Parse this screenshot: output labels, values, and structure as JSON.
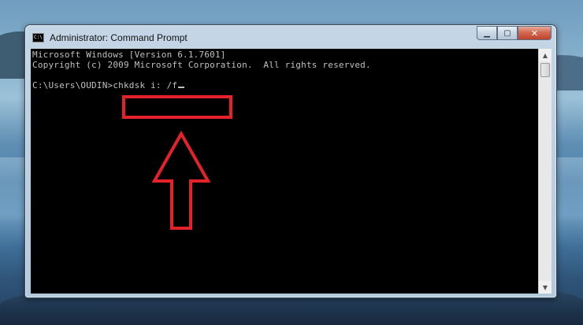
{
  "window": {
    "icon_text": "C:\\",
    "title": "Administrator: Command Prompt",
    "minimize_glyph": "▁",
    "maximize_glyph": "▢",
    "close_glyph": "✕"
  },
  "console": {
    "line1": "Microsoft Windows [Version 6.1.7601]",
    "line2": "Copyright (c) 2009 Microsoft Corporation.  All rights reserved.",
    "prompt": "C:\\Users\\OUDIN>",
    "command": "chkdsk i: /f",
    "text_color": "#c0c0c0",
    "background_color": "#000000"
  },
  "annotation": {
    "highlight_color": "#e5222a",
    "arrow_icon": "up-arrow-outline-icon"
  },
  "scrollbar": {
    "up_glyph": "▲",
    "down_glyph": "▼"
  }
}
